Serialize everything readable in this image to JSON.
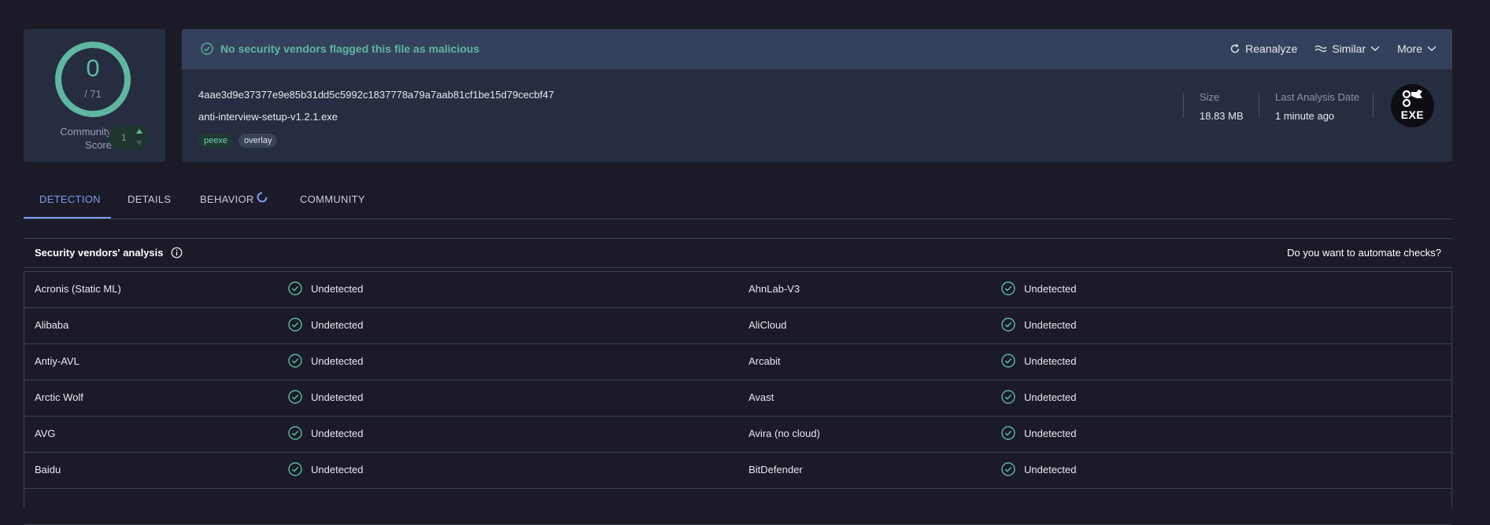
{
  "score": {
    "detections": "0",
    "total": "/ 71",
    "community_label_line1": "Community",
    "community_label_line2": "Score",
    "community_value": "1",
    "ring_color": "#5fb7a0"
  },
  "file": {
    "verdict": "No security vendors flagged this file as malicious",
    "hash": "4aae3d9e37377e9e85b31dd5c5992c1837778a79a7aab81cf1be15d79cecbf47",
    "name": "anti-interview-setup-v1.2.1.exe",
    "tags": [
      "peexe",
      "overlay"
    ],
    "size_label": "Size",
    "size_value": "18.83 MB",
    "date_label": "Last Analysis Date",
    "date_value": "1 minute ago",
    "type_badge": "EXE"
  },
  "actions": {
    "reanalyze": "Reanalyze",
    "similar": "Similar",
    "more": "More"
  },
  "tabs": [
    "DETECTION",
    "DETAILS",
    "BEHAVIOR",
    "COMMUNITY"
  ],
  "vendors": {
    "title": "Security vendors' analysis",
    "automate": "Do you want to automate checks?",
    "rows": [
      {
        "left_name": "Acronis (Static ML)",
        "left_status": "Undetected",
        "right_name": "AhnLab-V3",
        "right_status": "Undetected"
      },
      {
        "left_name": "Alibaba",
        "left_status": "Undetected",
        "right_name": "AliCloud",
        "right_status": "Undetected"
      },
      {
        "left_name": "Antiy-AVL",
        "left_status": "Undetected",
        "right_name": "Arcabit",
        "right_status": "Undetected"
      },
      {
        "left_name": "Arctic Wolf",
        "left_status": "Undetected",
        "right_name": "Avast",
        "right_status": "Undetected"
      },
      {
        "left_name": "AVG",
        "left_status": "Undetected",
        "right_name": "Avira (no cloud)",
        "right_status": "Undetected"
      },
      {
        "left_name": "Baidu",
        "left_status": "Undetected",
        "right_name": "BitDefender",
        "right_status": "Undetected"
      },
      {
        "left_name": "",
        "left_status": "",
        "right_name": "",
        "right_status": ""
      }
    ]
  },
  "colors": {
    "accent": "#7b9cf5",
    "clean": "#5fb7a0",
    "background": "#1a1b26",
    "card": "#272d40"
  }
}
